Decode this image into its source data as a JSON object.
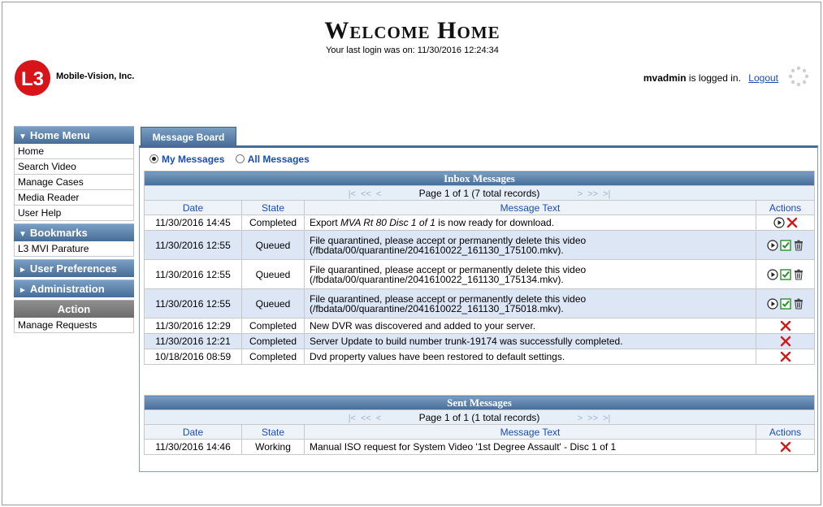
{
  "header": {
    "company": "Mobile-Vision, Inc.",
    "logo_text": "L3",
    "title": "Welcome Home",
    "last_login": "Your last login was on: 11/30/2016 12:24:34",
    "username": "mvadmin",
    "logged_in_suffix": " is logged in.",
    "logout_label": "Logout"
  },
  "sidebar": {
    "home_menu": {
      "label": "Home Menu",
      "items": [
        "Home",
        "Search Video",
        "Manage Cases",
        "Media Reader",
        "User Help"
      ]
    },
    "bookmarks": {
      "label": "Bookmarks",
      "items": [
        "L3 MVI Parature"
      ]
    },
    "user_preferences": {
      "label": "User Preferences"
    },
    "administration": {
      "label": "Administration"
    },
    "action": {
      "label": "Action",
      "items": [
        "Manage Requests"
      ]
    }
  },
  "tab": {
    "label": "Message Board"
  },
  "filters": {
    "my_messages": "My Messages",
    "all_messages": "All Messages",
    "selected": "my_messages"
  },
  "inbox": {
    "title": "Inbox Messages",
    "pager": "Page 1 of 1 (7 total records)",
    "columns": {
      "date": "Date",
      "state": "State",
      "text": "Message Text",
      "actions": "Actions"
    },
    "rows": [
      {
        "date": "11/30/2016 14:45",
        "state": "Completed",
        "text_pre": "Export ",
        "text_em": "MVA Rt 80 Disc 1 of 1",
        "text_post": " is now ready for download.",
        "line2": "",
        "actions": [
          "play",
          "delete"
        ]
      },
      {
        "date": "11/30/2016 12:55",
        "state": "Queued",
        "text_pre": "File quarantined, please accept or permanently delete this video",
        "text_em": "",
        "text_post": "",
        "line2": "(/fbdata/00/quarantine/2041610022_161130_175100.mkv).",
        "actions": [
          "play",
          "accept",
          "trash"
        ]
      },
      {
        "date": "11/30/2016 12:55",
        "state": "Queued",
        "text_pre": "File quarantined, please accept or permanently delete this video",
        "text_em": "",
        "text_post": "",
        "line2": "(/fbdata/00/quarantine/2041610022_161130_175134.mkv).",
        "actions": [
          "play",
          "accept",
          "trash"
        ]
      },
      {
        "date": "11/30/2016 12:55",
        "state": "Queued",
        "text_pre": "File quarantined, please accept or permanently delete this video",
        "text_em": "",
        "text_post": "",
        "line2": "(/fbdata/00/quarantine/2041610022_161130_175018.mkv).",
        "actions": [
          "play",
          "accept",
          "trash"
        ]
      },
      {
        "date": "11/30/2016 12:29",
        "state": "Completed",
        "text_pre": "New DVR was discovered and added to your server.",
        "text_em": "",
        "text_post": "",
        "line2": "",
        "actions": [
          "delete"
        ]
      },
      {
        "date": "11/30/2016 12:21",
        "state": "Completed",
        "text_pre": "Server Update to build number trunk-19174 was successfully completed.",
        "text_em": "",
        "text_post": "",
        "line2": "",
        "actions": [
          "delete"
        ]
      },
      {
        "date": "10/18/2016 08:59",
        "state": "Completed",
        "text_pre": "Dvd property values have been restored to default settings.",
        "text_em": "",
        "text_post": "",
        "line2": "",
        "actions": [
          "delete"
        ]
      }
    ]
  },
  "sent": {
    "title": "Sent Messages",
    "pager": "Page 1 of 1 (1 total records)",
    "columns": {
      "date": "Date",
      "state": "State",
      "text": "Message Text",
      "actions": "Actions"
    },
    "rows": [
      {
        "date": "11/30/2016 14:46",
        "state": "Working",
        "text_pre": "Manual ISO request for System Video '1st Degree Assault' - Disc 1 of 1",
        "text_em": "",
        "text_post": "",
        "line2": "",
        "actions": [
          "delete"
        ]
      }
    ]
  },
  "colors": {
    "accent": "#476d97",
    "row_alt": "#dde6f5",
    "link": "#1a4db3",
    "delete": "#d11a1a",
    "accept": "#2e8b2e"
  }
}
